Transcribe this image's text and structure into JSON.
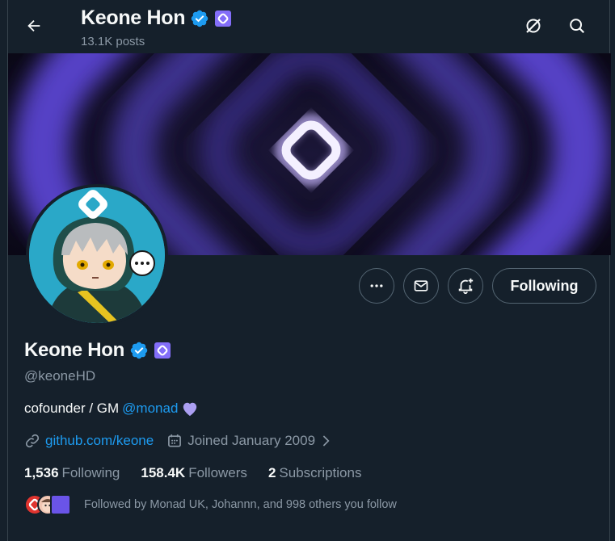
{
  "header": {
    "name": "Keone Hon",
    "posts": "13.1K posts"
  },
  "profile": {
    "name": "Keone Hon",
    "handle": "@keoneHD",
    "bio_text": "cofounder / GM",
    "bio_mention": "@monad",
    "website": "github.com/keone",
    "joined": "Joined January 2009"
  },
  "actions": {
    "following_label": "Following"
  },
  "stats": {
    "following_count": "1,536",
    "following_label": "Following",
    "followers_count": "158.4K",
    "followers_label": "Followers",
    "subscriptions_count": "2",
    "subscriptions_label": "Subscriptions"
  },
  "followed_by": "Followed by Monad UK, Johannn, and 998 others you follow",
  "colors": {
    "background": "#15202b",
    "accent": "#1d9bf0",
    "monad_purple": "#836ef9",
    "muted": "#8b98a5"
  },
  "icons": [
    "back-arrow-icon",
    "grok-icon",
    "search-icon",
    "verified-badge-icon",
    "monad-affiliate-icon",
    "more-icon",
    "message-icon",
    "notify-icon",
    "link-icon",
    "calendar-icon",
    "chevron-right-icon",
    "purple-heart-icon"
  ]
}
